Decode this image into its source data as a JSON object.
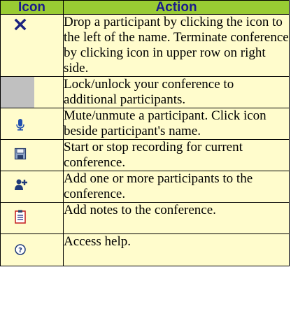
{
  "header": {
    "icon": "Icon",
    "action": "Action"
  },
  "colors": {
    "header_bg": "#99cc33",
    "header_text": "#1a1a8c",
    "cell_bg": "#fffccc"
  },
  "rows": [
    {
      "icon": "close-x-icon",
      "text": "Drop a participant by clicking the icon to the left of the name. Terminate conference by clicking icon in upper row on right side."
    },
    {
      "icon": "lock-placeholder-icon",
      "text": "Lock/unlock your conference to additional participants."
    },
    {
      "icon": "microphone-icon",
      "text": "Mute/unmute a participant. Click icon beside participant's name."
    },
    {
      "icon": "save-disk-icon",
      "text": "Start or stop recording for current conference."
    },
    {
      "icon": "add-participant-icon",
      "text": "Add one or more participants to the conference."
    },
    {
      "icon": "notes-clipboard-icon",
      "text": "Add notes to the conference."
    },
    {
      "icon": "help-icon",
      "text": "Access help."
    }
  ]
}
